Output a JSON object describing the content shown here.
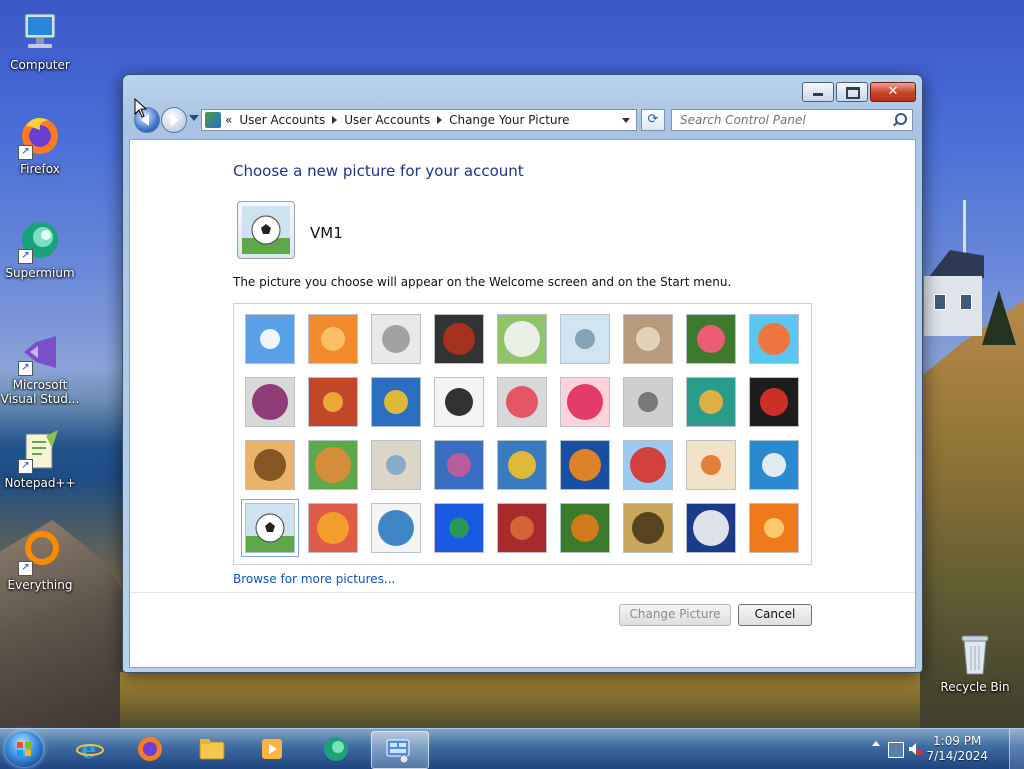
{
  "desktop": {
    "icons": [
      {
        "label": "Computer",
        "icon": "computer-icon"
      },
      {
        "label": "Firefox",
        "icon": "firefox-icon"
      },
      {
        "label": "Supermium",
        "icon": "supermium-icon"
      },
      {
        "label": "Microsoft Visual Stud...",
        "icon": "visual-studio-icon"
      },
      {
        "label": "Notepad++",
        "icon": "notepadpp-icon"
      },
      {
        "label": "Everything",
        "icon": "everything-icon"
      },
      {
        "label": "Recycle Bin",
        "icon": "recycle-bin-icon"
      }
    ]
  },
  "window": {
    "breadcrumb": {
      "overflow": "«",
      "items": [
        "User Accounts",
        "User Accounts",
        "Change Your Picture"
      ]
    },
    "search": {
      "placeholder": "Search Control Panel",
      "value": ""
    },
    "heading": "Choose a new picture for your account",
    "username": "VM1",
    "description": "The picture you choose will appear on the Welcome screen and on the Start menu.",
    "pictures": [
      "roller-coaster",
      "starfish",
      "robot-toy",
      "turntable",
      "lucky-cat",
      "gyroscope",
      "kitten",
      "flower-pink",
      "pinwheel",
      "ball-purple",
      "fabric-stripes",
      "yellow-leaf",
      "dog-collie",
      "crayons",
      "star-lantern",
      "jacks",
      "stairs",
      "paper-crane",
      "guitar",
      "pomeranian",
      "tin-robot",
      "scarves",
      "sunflower",
      "fish-orange",
      "hot-air-balloon",
      "doll",
      "sailboat",
      "soccer-ball",
      "woven-fabric",
      "marbles",
      "window-frame",
      "rug-pattern",
      "butterfly",
      "spiral-shell",
      "lighthouse",
      "orange-flower"
    ],
    "selected_picture": "soccer-ball",
    "browse_link": "Browse for more pictures...",
    "change_button": "Change Picture",
    "cancel_button": "Cancel"
  },
  "taskbar": {
    "apps": [
      "internet-explorer-icon",
      "firefox-icon",
      "file-explorer-icon",
      "media-player-icon",
      "supermium-icon",
      "control-panel-icon"
    ],
    "time": "1:09 PM",
    "date": "7/14/2024"
  }
}
